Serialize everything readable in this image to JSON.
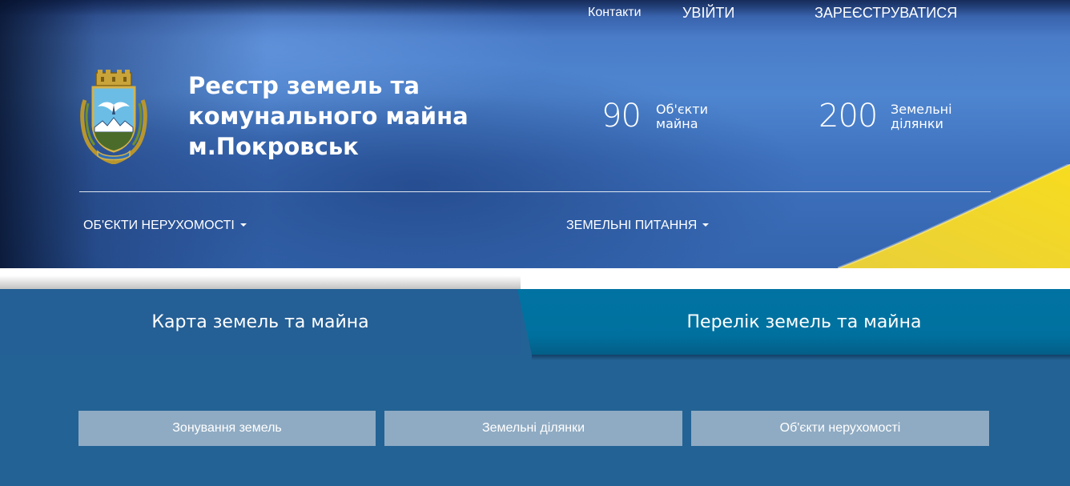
{
  "header": {
    "contacts_label": "Контакти",
    "login_label": "УВІЙТИ",
    "register_label": "ЗАРЕЄСТРУВАТИСЯ",
    "title_lines": [
      "Реєстр земель та",
      "комунального майна",
      "м.Покровськ"
    ],
    "stats": [
      {
        "value": "90",
        "label_lines": [
          "Об'єкти",
          "майна"
        ]
      },
      {
        "value": "200",
        "label_lines": [
          "Земельні",
          "ділянки"
        ]
      }
    ],
    "menu": [
      {
        "label": "ОБ'ЄКТИ НЕРУХОМОСТІ",
        "icon": "caret-down-icon"
      },
      {
        "label": "ЗЕМЕЛЬНІ ПИТАННЯ",
        "icon": "caret-down-icon"
      }
    ],
    "coat_of_arms_icon": "pokrovsk-coat-of-arms-icon"
  },
  "tabs": [
    {
      "label": "Карта земель та майна",
      "active": true
    },
    {
      "label": "Перелік земель та майна",
      "active": false
    }
  ],
  "buttons": [
    "Зонування земель",
    "Земельні ділянки",
    "Об'єкти нерухомості"
  ],
  "colors": {
    "hero_blue": "#4f86d0",
    "panel_blue": "#236294",
    "tab_teal": "#0173a3",
    "button_gray": "#8fabc3",
    "flag_yellow": "#f2d52a"
  }
}
